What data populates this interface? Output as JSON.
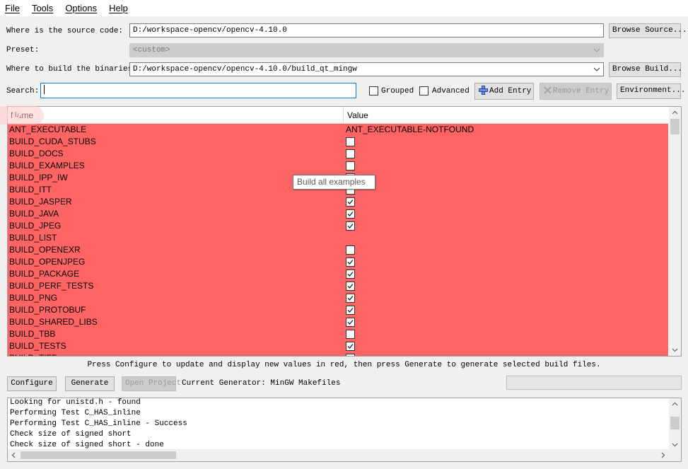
{
  "menu": [
    "File",
    "Tools",
    "Options",
    "Help"
  ],
  "source": {
    "label": "Where is the source code:",
    "value": "D:/workspace-opencv/opencv-4.10.0",
    "browse_label": "Browse Source..."
  },
  "preset": {
    "label": "Preset:",
    "value": "<custom>"
  },
  "build": {
    "label": "Where to build the binaries:",
    "value": "D:/workspace-opencv/opencv-4.10.0/build_qt_mingw",
    "browse_label": "Browse Build..."
  },
  "search": {
    "label": "Search:",
    "value": "",
    "grouped_label": "Grouped",
    "grouped_checked": false,
    "advanced_label": "Advanced",
    "advanced_checked": false,
    "add_entry_label": "Add Entry",
    "remove_entry_label": "Remove Entry",
    "environment_label": "Environment..."
  },
  "table": {
    "columns": [
      "Name",
      "Value"
    ],
    "row_color": "#ff6464",
    "rows": [
      {
        "name": "ANT_EXECUTABLE",
        "type": "text",
        "value": "ANT_EXECUTABLE-NOTFOUND"
      },
      {
        "name": "BUILD_CUDA_STUBS",
        "type": "bool",
        "checked": false
      },
      {
        "name": "BUILD_DOCS",
        "type": "bool",
        "checked": false
      },
      {
        "name": "BUILD_EXAMPLES",
        "type": "bool",
        "checked": false
      },
      {
        "name": "BUILD_IPP_IW",
        "type": "bool",
        "checked": false
      },
      {
        "name": "BUILD_ITT",
        "type": "bool",
        "checked": false
      },
      {
        "name": "BUILD_JASPER",
        "type": "bool",
        "checked": true
      },
      {
        "name": "BUILD_JAVA",
        "type": "bool",
        "checked": true
      },
      {
        "name": "BUILD_JPEG",
        "type": "bool",
        "checked": true
      },
      {
        "name": "BUILD_LIST",
        "type": "text",
        "value": ""
      },
      {
        "name": "BUILD_OPENEXR",
        "type": "bool",
        "checked": false
      },
      {
        "name": "BUILD_OPENJPEG",
        "type": "bool",
        "checked": true
      },
      {
        "name": "BUILD_PACKAGE",
        "type": "bool",
        "checked": true
      },
      {
        "name": "BUILD_PERF_TESTS",
        "type": "bool",
        "checked": true
      },
      {
        "name": "BUILD_PNG",
        "type": "bool",
        "checked": true
      },
      {
        "name": "BUILD_PROTOBUF",
        "type": "bool",
        "checked": true
      },
      {
        "name": "BUILD_SHARED_LIBS",
        "type": "bool",
        "checked": true
      },
      {
        "name": "BUILD_TBB",
        "type": "bool",
        "checked": false
      },
      {
        "name": "BUILD_TESTS",
        "type": "bool",
        "checked": true
      },
      {
        "name": "BUILD_TIFF",
        "type": "bool",
        "checked": true
      }
    ]
  },
  "tooltip": "Build all examples",
  "hint": "Press Configure to update and display new values in red, then press Generate to generate selected build files.",
  "actions": {
    "configure_label": "Configure",
    "generate_label": "Generate",
    "open_project_label": "Open Project",
    "generator_text": "Current Generator: MinGW Makefiles"
  },
  "log": [
    "Looking for unistd.h - found",
    "Performing Test C_HAS_inline",
    "Performing Test C_HAS_inline - Success",
    "Check size of signed short",
    "Check size of signed short - done"
  ]
}
